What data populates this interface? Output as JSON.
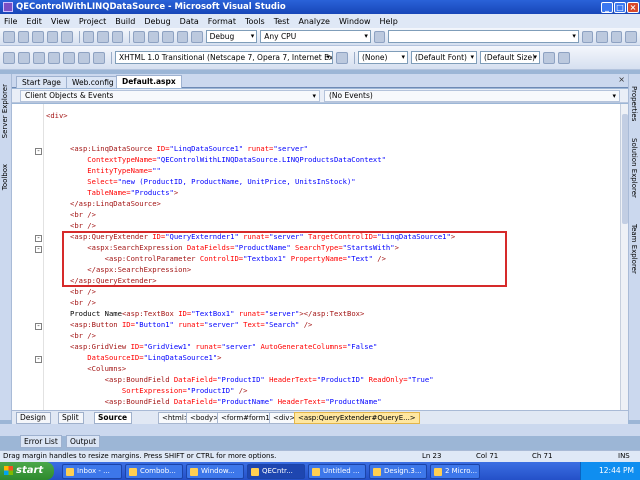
{
  "window": {
    "title": "QEControlWithLINQDataSource - Microsoft Visual Studio"
  },
  "menu": [
    "File",
    "Edit",
    "View",
    "Project",
    "Build",
    "Debug",
    "Data",
    "Format",
    "Tools",
    "Test",
    "Analyze",
    "Window",
    "Help"
  ],
  "toolbar1": {
    "config": "Debug",
    "platform": "Any CPU"
  },
  "toolbar2": {
    "doctype": "XHTML 1.0 Transitional (Netscape 7, Opera 7, Internet Explorer 6)",
    "style": "(None)",
    "font": "(Default Font)",
    "size": "(Default Size)"
  },
  "side_left": [
    "Server Explorer",
    "Toolbox"
  ],
  "side_right": [
    "Properties",
    "Solution Explorer",
    "Team Explorer"
  ],
  "tabs": [
    "Start Page",
    "Web.config",
    "Default.aspx"
  ],
  "nav": {
    "left": "Client Objects & Events",
    "right": "(No Events)"
  },
  "code": [
    [
      [
        "t",
        "<div>"
      ]
    ],
    [],
    [],
    [
      [
        "t",
        "<asp:LinqDataSource "
      ],
      [
        "a",
        "ID="
      ],
      [
        "v",
        "\"LinqDataSource1\" "
      ],
      [
        "a",
        "runat="
      ],
      [
        "v",
        "\"server\""
      ]
    ],
    [
      [
        "a",
        "    ContextTypeName="
      ],
      [
        "v",
        "\"QEControlWithLINQDataSource.LINQProductsDataContext\""
      ]
    ],
    [
      [
        "a",
        "    EntityTypeName="
      ],
      [
        "v",
        "\"\""
      ]
    ],
    [
      [
        "a",
        "    Select="
      ],
      [
        "v",
        "\"new (ProductID, ProductName, UnitPrice, UnitsInStock)\""
      ]
    ],
    [
      [
        "a",
        "    TableName="
      ],
      [
        "v",
        "\"Products\""
      ],
      [
        "t",
        ">"
      ]
    ],
    [
      [
        "t",
        "</asp:LinqDataSource>"
      ]
    ],
    [
      [
        "t",
        "<br />"
      ]
    ],
    [
      [
        "t",
        "<br />"
      ]
    ],
    [
      [
        "t",
        "<asp:QueryExtender "
      ],
      [
        "a",
        "ID="
      ],
      [
        "v",
        "\"QueryExternder1\" "
      ],
      [
        "a",
        "runat="
      ],
      [
        "v",
        "\"server\" "
      ],
      [
        "a",
        "TargetControlID="
      ],
      [
        "v",
        "\"LinqDataSource1\""
      ],
      [
        "t",
        ">"
      ]
    ],
    [
      [
        "t",
        "    <aspx:SearchExpression "
      ],
      [
        "a",
        "DataFields="
      ],
      [
        "v",
        "\"ProductName\" "
      ],
      [
        "a",
        "SearchType="
      ],
      [
        "v",
        "\"StartsWith\""
      ],
      [
        "t",
        ">"
      ]
    ],
    [
      [
        "t",
        "        <asp:ControlParameter "
      ],
      [
        "a",
        "ControlID="
      ],
      [
        "v",
        "\"Textbox1\" "
      ],
      [
        "a",
        "PropertyName="
      ],
      [
        "v",
        "\"Text\" "
      ],
      [
        "t",
        "/>"
      ]
    ],
    [
      [
        "t",
        "    </aspx:SearchExpression>"
      ]
    ],
    [
      [
        "t",
        "</asp:QueryExtender>"
      ]
    ],
    [
      [
        "t",
        "<br />"
      ]
    ],
    [
      [
        "t",
        "<br />"
      ]
    ],
    [
      [
        "x",
        "Product Name"
      ],
      [
        "t",
        "<asp:TextBox "
      ],
      [
        "a",
        "ID="
      ],
      [
        "v",
        "\"TextBox1\" "
      ],
      [
        "a",
        "runat="
      ],
      [
        "v",
        "\"server\""
      ],
      [
        "t",
        "></asp:TextBox>"
      ]
    ],
    [
      [
        "t",
        "<asp:Button "
      ],
      [
        "a",
        "ID="
      ],
      [
        "v",
        "\"Button1\" "
      ],
      [
        "a",
        "runat="
      ],
      [
        "v",
        "\"server\" "
      ],
      [
        "a",
        "Text="
      ],
      [
        "v",
        "\"Search\" "
      ],
      [
        "t",
        "/>"
      ]
    ],
    [
      [
        "t",
        "<br />"
      ]
    ],
    [
      [
        "t",
        "<asp:GridView "
      ],
      [
        "a",
        "ID="
      ],
      [
        "v",
        "\"GridView1\" "
      ],
      [
        "a",
        "runat="
      ],
      [
        "v",
        "\"server\" "
      ],
      [
        "a",
        "AutoGenerateColumns="
      ],
      [
        "v",
        "\"False\""
      ]
    ],
    [
      [
        "a",
        "    DataSourceID="
      ],
      [
        "v",
        "\"LinqDataSource1\""
      ],
      [
        "t",
        ">"
      ]
    ],
    [
      [
        "t",
        "    <Columns>"
      ]
    ],
    [
      [
        "t",
        "        <asp:BoundField "
      ],
      [
        "a",
        "DataField="
      ],
      [
        "v",
        "\"ProductID\" "
      ],
      [
        "a",
        "HeaderText="
      ],
      [
        "v",
        "\"ProductID\" "
      ],
      [
        "a",
        "ReadOnly="
      ],
      [
        "v",
        "\"True\""
      ]
    ],
    [
      [
        "a",
        "            SortExpression="
      ],
      [
        "v",
        "\"ProductID\" "
      ],
      [
        "t",
        "/>"
      ]
    ],
    [
      [
        "t",
        "        <asp:BoundField "
      ],
      [
        "a",
        "DataField="
      ],
      [
        "v",
        "\"ProductName\" "
      ],
      [
        "a",
        "HeaderText="
      ],
      [
        "v",
        "\"ProductName\""
      ]
    ]
  ],
  "viewbar": {
    "buttons": [
      "Design",
      "Split",
      "Source"
    ],
    "crumbs": [
      "<html>",
      "<body>",
      "<form#form1>",
      "<div>",
      "<asp:QueryExtender#QueryE...>"
    ]
  },
  "output_tabs": [
    "Error List",
    "Output"
  ],
  "status": {
    "message": "Drag margin handles to resize margins. Press SHIFT or CTRL for more options.",
    "ln": "Ln 23",
    "col": "Col 71",
    "ch": "Ch 71",
    "mode": "INS"
  },
  "taskbar": {
    "start": "start",
    "items": [
      "Inbox - ...",
      "Combob...",
      "Window...",
      "QECntr...",
      "Untitled ...",
      "Design.3...",
      "2 Micro..."
    ],
    "time": "12:44 PM"
  }
}
